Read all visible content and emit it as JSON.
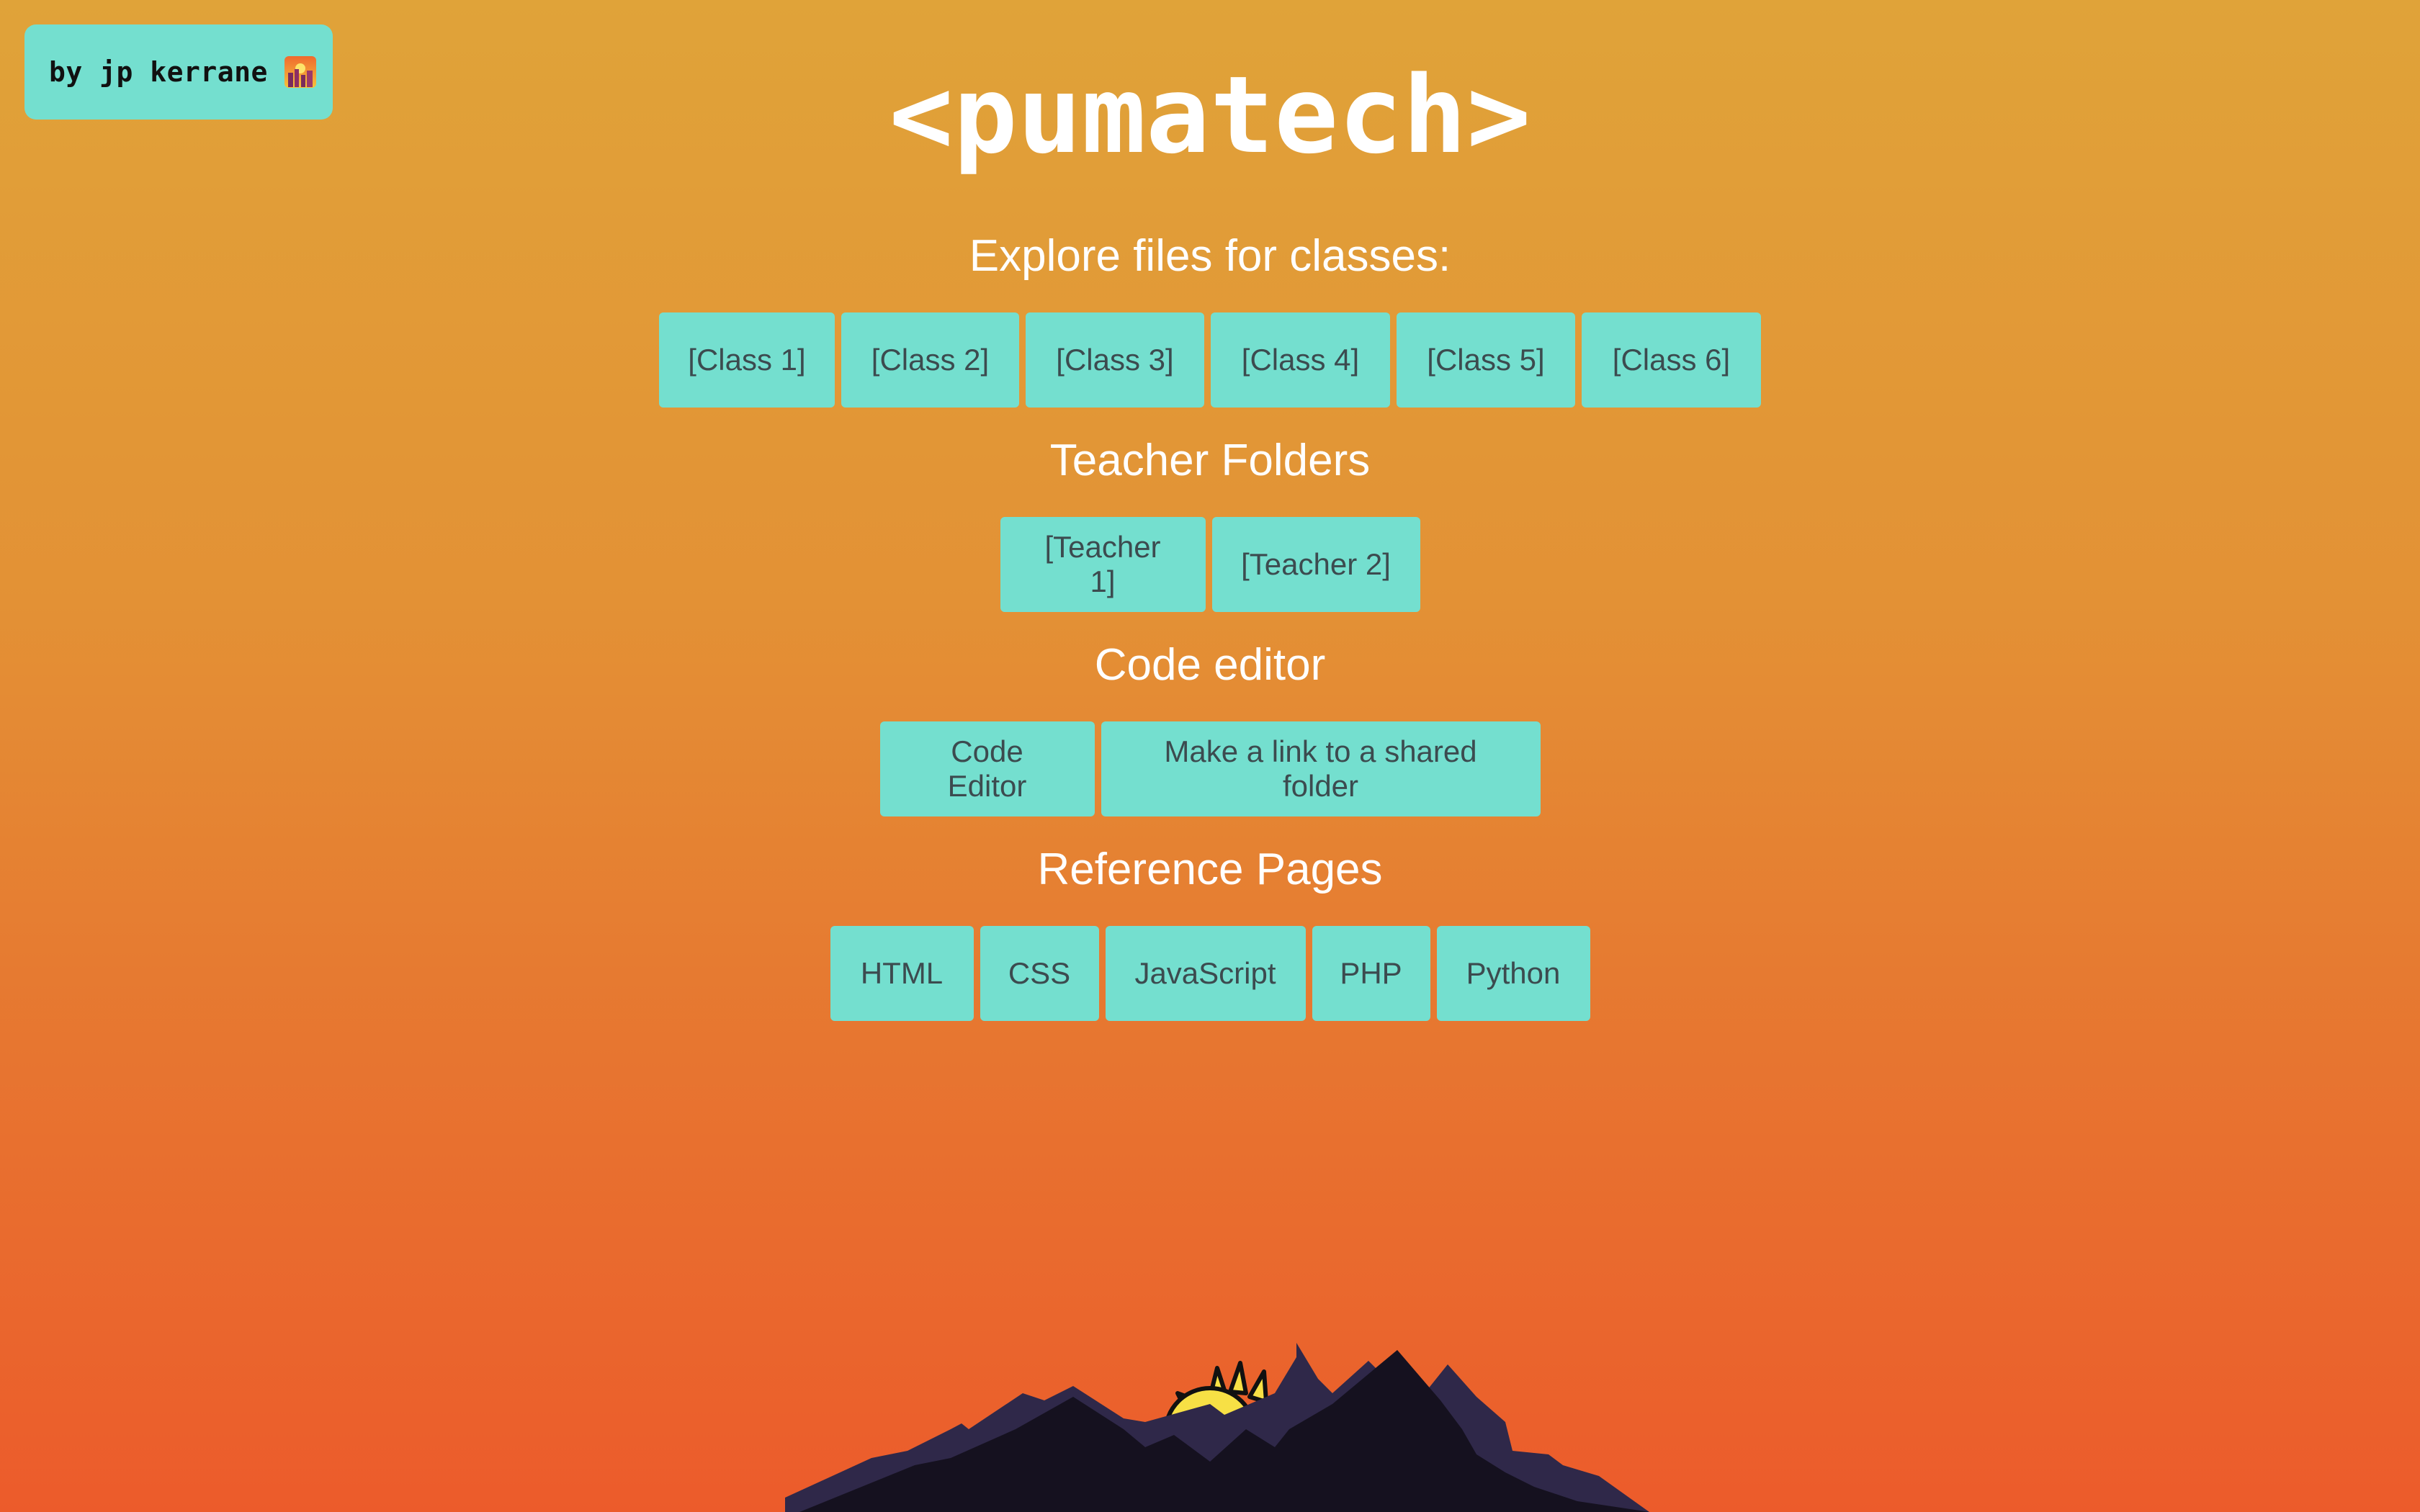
{
  "author_badge": {
    "label": "by jp kerrane",
    "emoji_icon": "sunset-city-emoji-icon"
  },
  "title": "<pumatech>",
  "sections": {
    "classes": {
      "heading": "Explore files for classes:",
      "buttons": [
        "[Class 1]",
        "[Class 2]",
        "[Class 3]",
        "[Class 4]",
        "[Class 5]",
        "[Class 6]"
      ]
    },
    "teachers": {
      "heading": "Teacher Folders",
      "buttons": [
        "[Teacher 1]",
        "[Teacher 2]"
      ]
    },
    "editor": {
      "heading": "Code editor",
      "buttons": [
        "Code Editor",
        "Make a link to a shared folder"
      ]
    },
    "reference": {
      "heading": "Reference Pages",
      "buttons": [
        "HTML",
        "CSS",
        "JavaScript",
        "PHP",
        "Python"
      ]
    }
  },
  "footer_art": "mountains-with-rising-sun-illustration",
  "colors": {
    "background_top": "#e0a339",
    "background_bottom": "#ec5b2b",
    "button_bg": "#74dfcf",
    "button_text": "#3c4b4f",
    "heading_text": "#ffffff",
    "sun": "#f7e045",
    "mountain_back": "#2f2849",
    "mountain_front": "#15111f"
  }
}
